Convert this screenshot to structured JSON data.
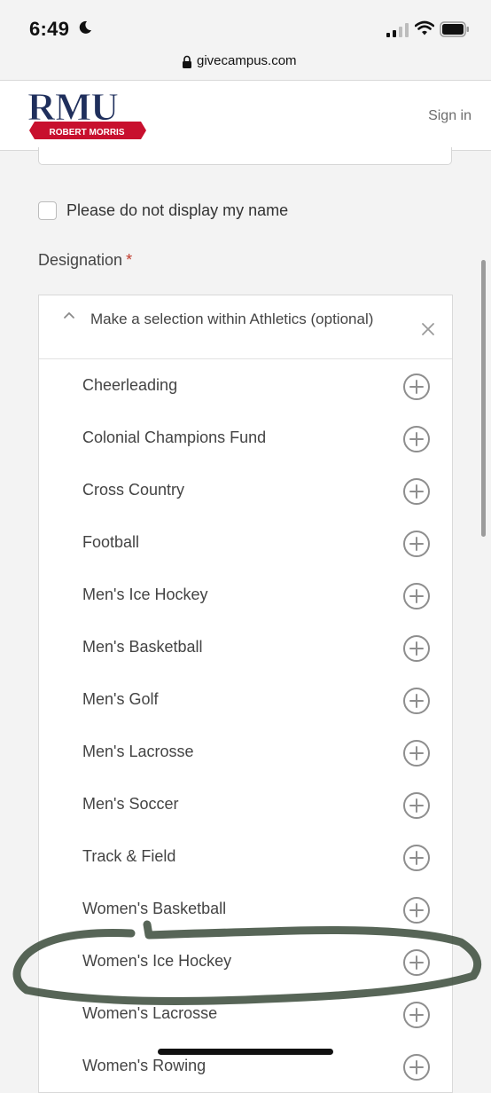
{
  "status_bar": {
    "time": "6:49"
  },
  "browser": {
    "url": "givecampus.com"
  },
  "header": {
    "logo_text": "RMU",
    "logo_banner": "ROBERT MORRIS",
    "sign_in": "Sign in"
  },
  "form": {
    "anonymous_label": "Please do not display my name",
    "designation_label": "Designation",
    "required_mark": "*",
    "select_title": "Make a selection within Athletics (optional)",
    "options": [
      "Cheerleading",
      "Colonial Champions Fund",
      "Cross Country",
      "Football",
      "Men's Ice Hockey",
      "Men's Basketball",
      "Men's Golf",
      "Men's Lacrosse",
      "Men's Soccer",
      "Track & Field",
      "Women's Basketball",
      "Women's Ice Hockey",
      "Women's Lacrosse",
      "Women's Rowing"
    ]
  },
  "icons": {
    "moon": "moon-icon",
    "signal": "cellular-signal-icon",
    "wifi": "wifi-icon",
    "battery": "battery-icon",
    "lock": "lock-icon",
    "chevron": "chevron-up-icon",
    "clear": "close-icon",
    "add": "plus-circle-icon"
  },
  "colors": {
    "brand_navy": "#1f2f5c",
    "brand_red": "#c8102e",
    "required": "#c0392b",
    "annotation": "#3a4a3a"
  }
}
